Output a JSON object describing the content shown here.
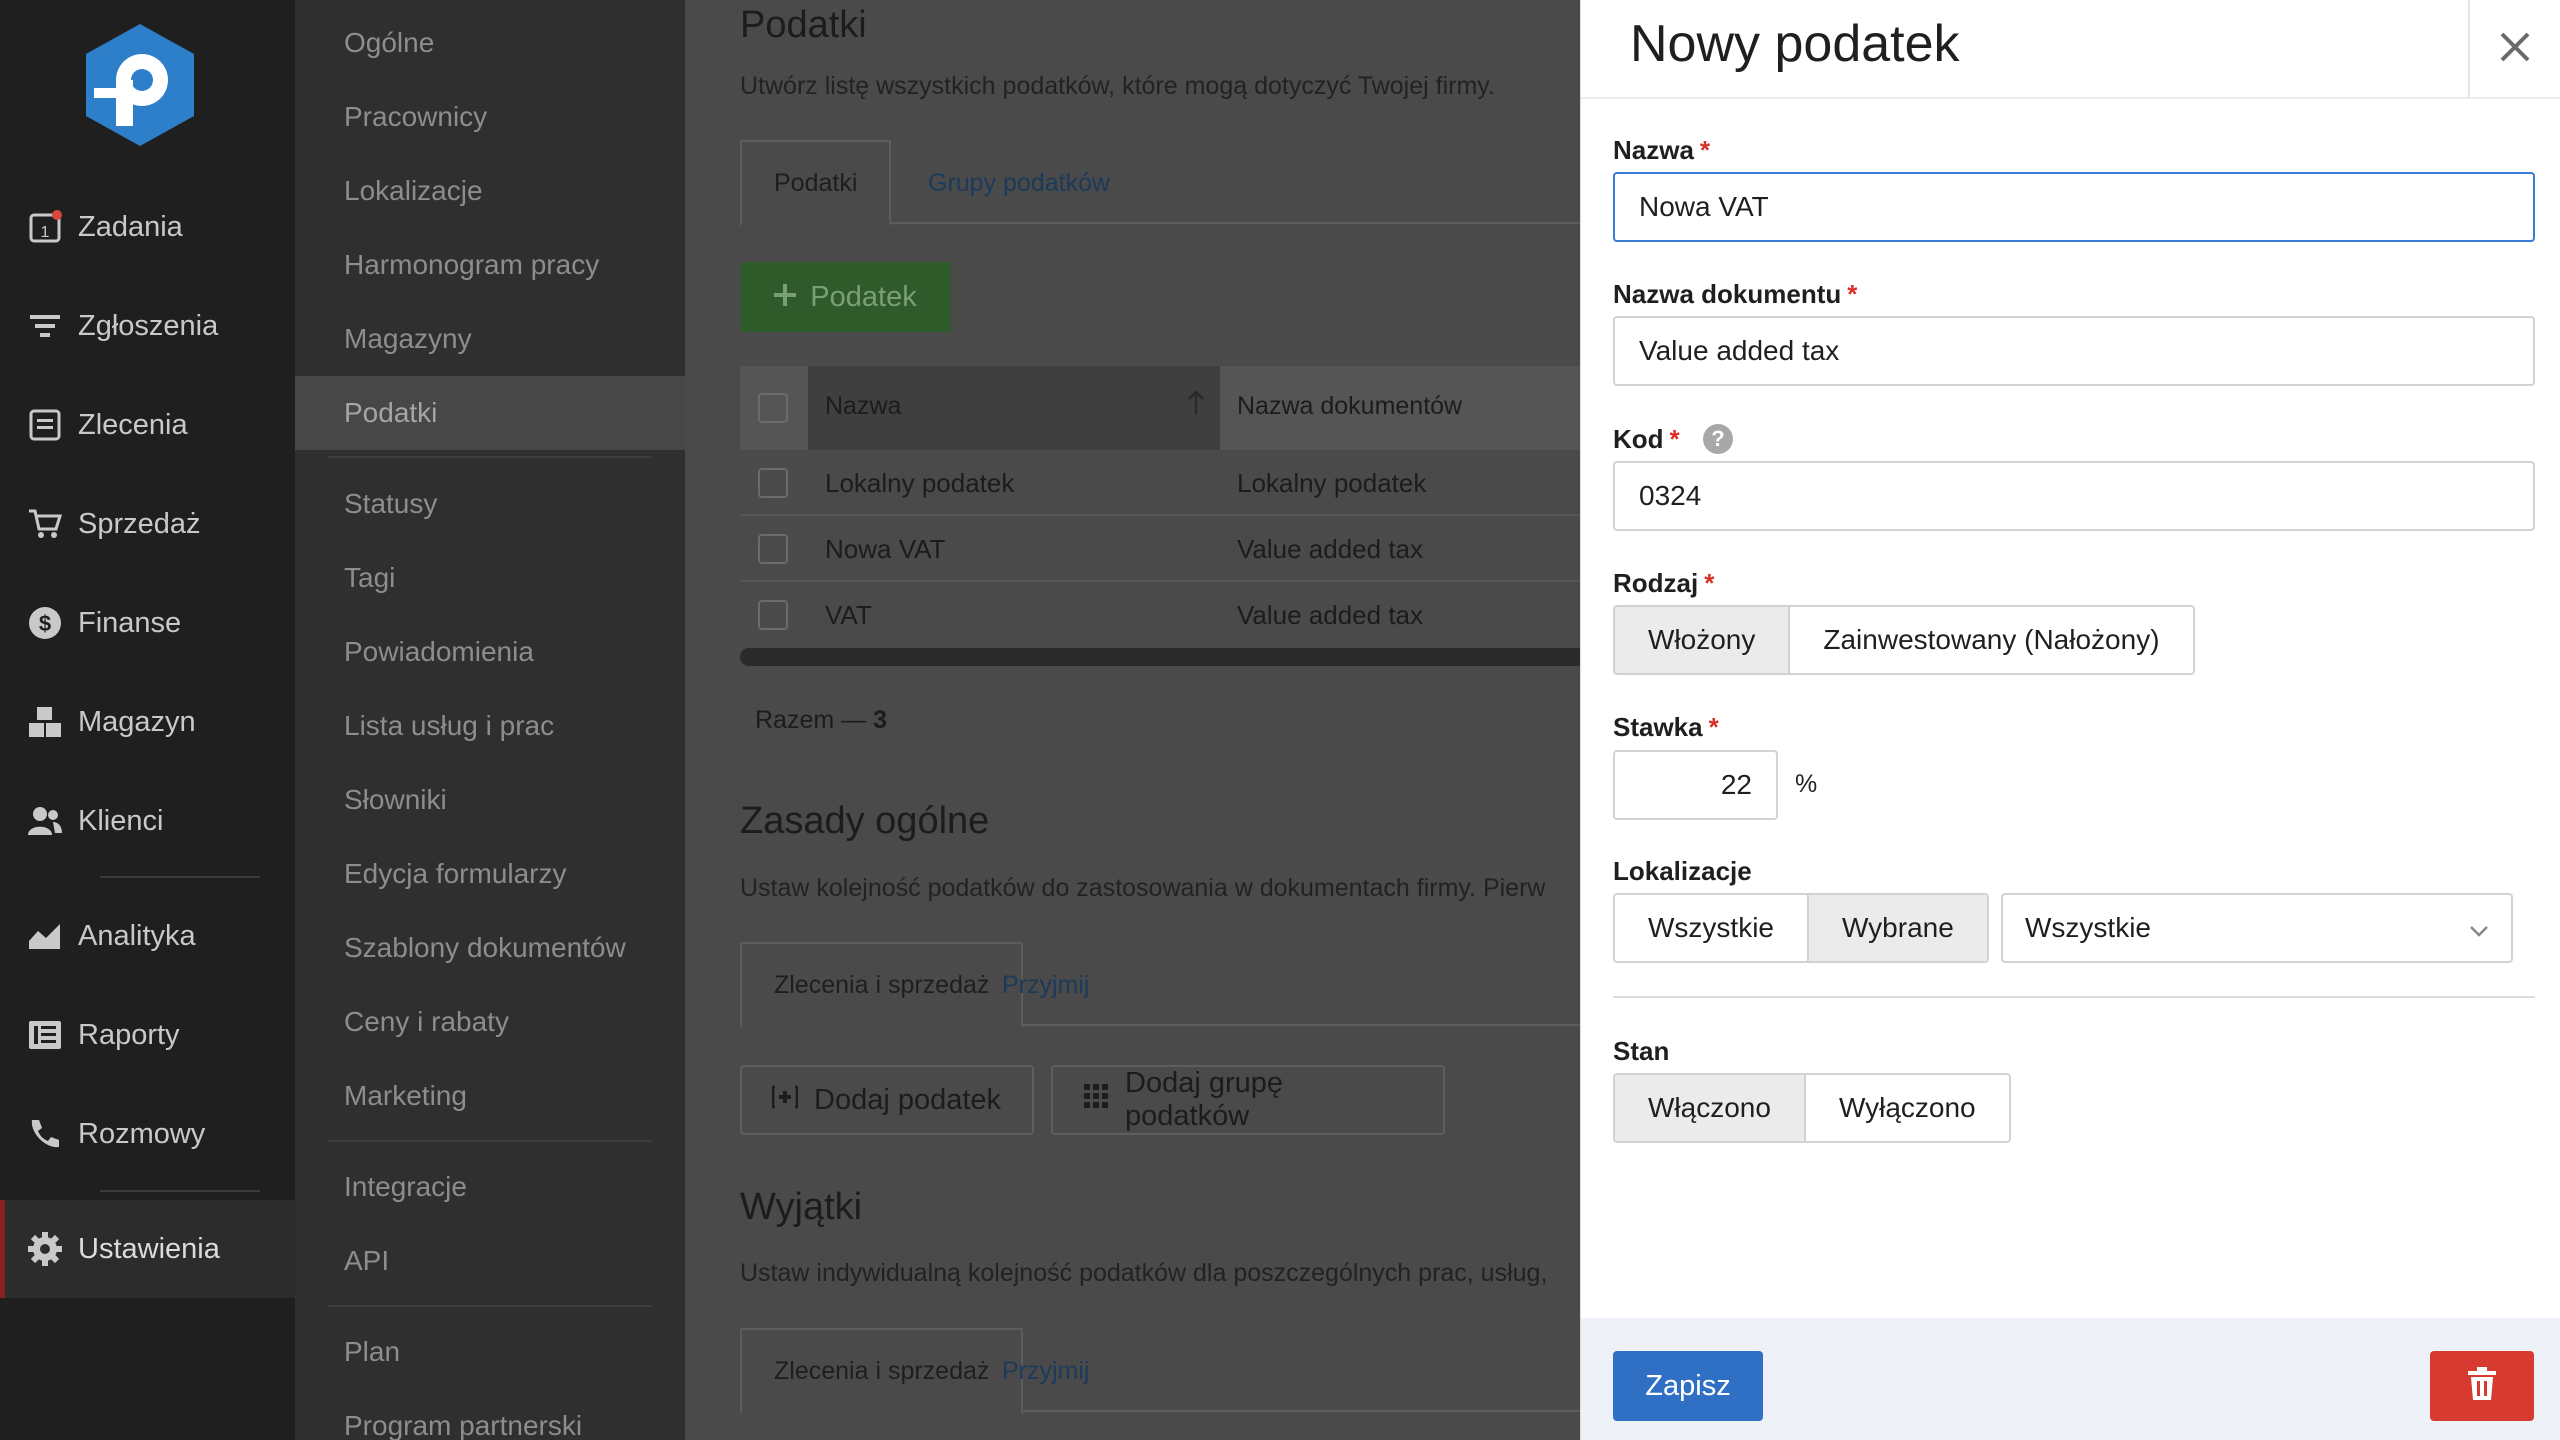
{
  "nav": {
    "items": [
      {
        "label": "Zadania",
        "icon": "calendar-icon"
      },
      {
        "label": "Zgłoszenia",
        "icon": "filter-icon"
      },
      {
        "label": "Zlecenia",
        "icon": "document-icon"
      },
      {
        "label": "Sprzedaż",
        "icon": "cart-icon"
      },
      {
        "label": "Finanse",
        "icon": "dollar-icon"
      },
      {
        "label": "Magazyn",
        "icon": "boxes-icon"
      },
      {
        "label": "Klienci",
        "icon": "users-icon"
      },
      {
        "label": "Analityka",
        "icon": "area-chart-icon"
      },
      {
        "label": "Raporty",
        "icon": "report-icon"
      },
      {
        "label": "Rozmowy",
        "icon": "phone-icon"
      },
      {
        "label": "Ustawienia",
        "icon": "gear-icon"
      }
    ]
  },
  "submenu": {
    "items": [
      "Ogólne",
      "Pracownicy",
      "Lokalizacje",
      "Harmonogram pracy",
      "Magazyny",
      "Podatki",
      "Statusy",
      "Tagi",
      "Powiadomienia",
      "Lista usług i prac",
      "Słowniki",
      "Edycja formularzy",
      "Szablony dokumentów",
      "Ceny i rabaty",
      "Marketing",
      "Integracje",
      "API",
      "Plan",
      "Program partnerski"
    ],
    "active": "Podatki"
  },
  "main": {
    "title": "Podatki",
    "description": "Utwórz listę wszystkich podatków, które mogą dotyczyć Twojej firmy.",
    "tabs": [
      "Podatki",
      "Grupy podatków"
    ],
    "add_button": "Podatek",
    "table": {
      "columns": [
        "Nazwa",
        "Nazwa dokumentów"
      ],
      "rows": [
        [
          "Lokalny podatek",
          "Lokalny podatek"
        ],
        [
          "Nowa VAT",
          "Value added tax"
        ],
        [
          "VAT",
          "Value added tax"
        ]
      ],
      "total_label": "Razem —",
      "total_count": "3"
    },
    "rules": {
      "title": "Zasady ogólne",
      "description": "Ustaw kolejność podatków do zastosowania w dokumentach firmy. Pierw",
      "tabs": [
        "Zlecenia i sprzedaż",
        "Przyjmij"
      ],
      "add_tax": "Dodaj podatek",
      "add_group": "Dodaj grupę podatków"
    },
    "exceptions": {
      "title": "Wyjątki",
      "description": "Ustaw indywidualną kolejność podatków dla poszczególnych prac, usług,",
      "tabs": [
        "Zlecenia i sprzedaż",
        "Przyjmij"
      ]
    }
  },
  "panel": {
    "title": "Nowy podatek",
    "fields": {
      "name_label": "Nazwa",
      "name_value": "Nowa VAT",
      "docname_label": "Nazwa dokumentu",
      "docname_value": "Value added tax",
      "code_label": "Kod",
      "code_value": "0324",
      "type_label": "Rodzaj",
      "type_options": [
        "Włożony",
        "Zainwestowany (Nałożony)"
      ],
      "type_selected": "Włożony",
      "rate_label": "Stawka",
      "rate_value": "22",
      "rate_unit": "%",
      "loc_label": "Lokalizacje",
      "loc_options": [
        "Wszystkie",
        "Wybrane"
      ],
      "loc_selected": "Wybrane",
      "loc_select_value": "Wszystkie",
      "state_label": "Stan",
      "state_options": [
        "Włączono",
        "Wyłączono"
      ],
      "state_selected": "Włączono"
    },
    "required_mark": "*",
    "help_mark": "?",
    "save": "Zapisz"
  },
  "colors": {
    "primary": "#2f6fc4",
    "danger": "#d63a30",
    "required": "#d93025",
    "logo": "#2e7fc9"
  }
}
